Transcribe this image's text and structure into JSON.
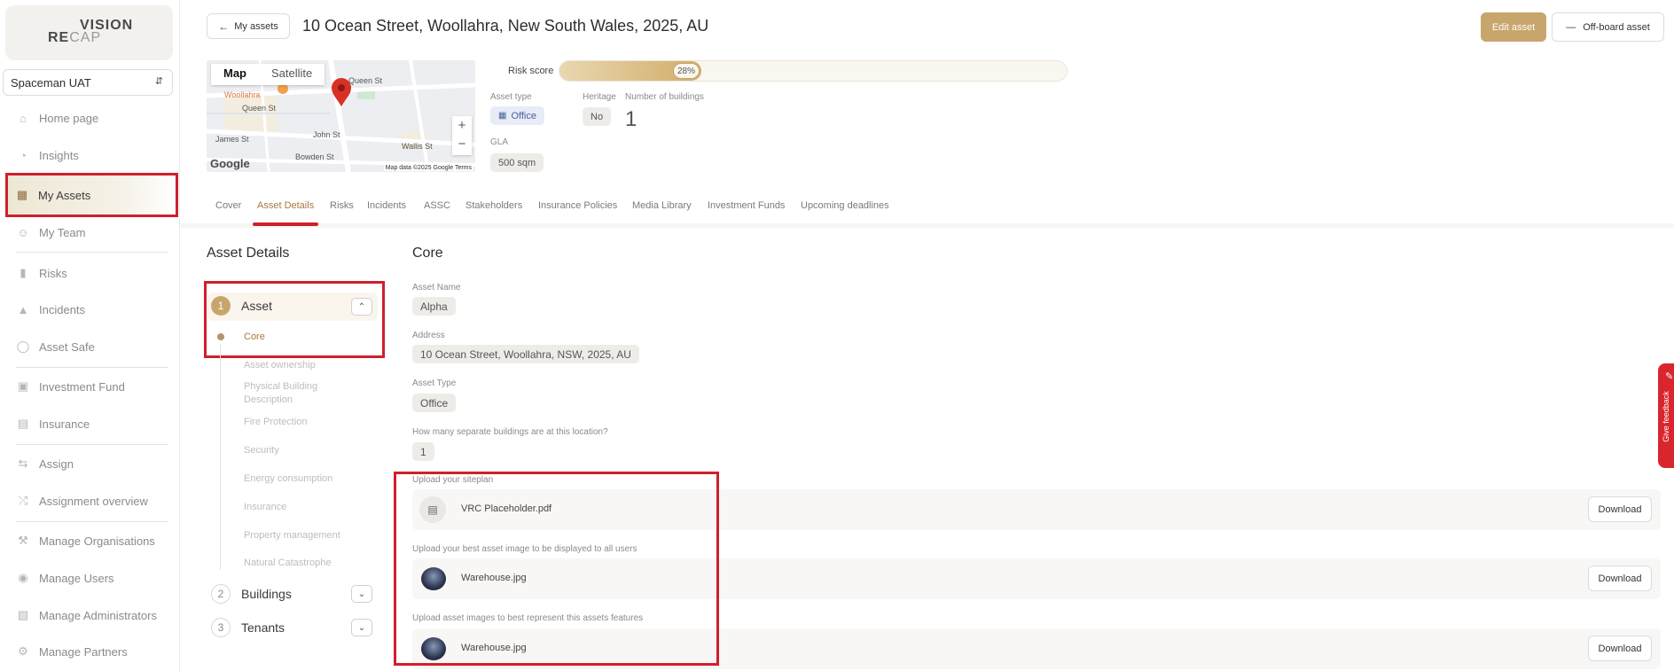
{
  "brand": {
    "line1": "VISION",
    "line2a": "RE",
    "line2b": "CAP"
  },
  "org_selector": {
    "value": "Spaceman UAT"
  },
  "sidebar": {
    "items": [
      {
        "label": "Home page",
        "icon": "home-icon"
      },
      {
        "label": "Insights",
        "icon": "insights-icon"
      },
      {
        "label": "My Assets",
        "icon": "building-icon",
        "active": true
      },
      {
        "label": "My Team",
        "icon": "team-icon"
      },
      {
        "label": "Risks",
        "icon": "chart-icon"
      },
      {
        "label": "Incidents",
        "icon": "flame-icon"
      },
      {
        "label": "Asset Safe",
        "icon": "shield-icon"
      },
      {
        "label": "Investment Fund",
        "icon": "wallet-icon"
      },
      {
        "label": "Insurance",
        "icon": "document-icon"
      },
      {
        "label": "Assign",
        "icon": "swap-icon"
      },
      {
        "label": "Assignment overview",
        "icon": "shuffle-icon"
      },
      {
        "label": "Manage Organisations",
        "icon": "wrench-icon"
      },
      {
        "label": "Manage Users",
        "icon": "user-icon"
      },
      {
        "label": "Manage Administrators",
        "icon": "admin-icon"
      },
      {
        "label": "Manage Partners",
        "icon": "gear-icon"
      }
    ]
  },
  "header": {
    "back_label": "My assets",
    "title": "10 Ocean Street, Woollahra, New South Wales, 2025, AU",
    "edit_label": "Edit asset",
    "offboard_label": "Off-board asset"
  },
  "map": {
    "tab_map": "Map",
    "tab_satellite": "Satellite",
    "attribution": "Map data ©2025 Google",
    "terms": "Terms",
    "google": "Google"
  },
  "risk": {
    "label": "Risk score",
    "percent_text": "28%",
    "percent": 28
  },
  "asset_meta": {
    "asset_type_label": "Asset type",
    "asset_type_value": "Office",
    "heritage_label": "Heritage",
    "heritage_value": "No",
    "buildings_label": "Number of buildings",
    "buildings_value": "1",
    "gla_label": "GLA",
    "gla_value": "500 sqm"
  },
  "tabs": [
    "Cover",
    "Asset Details",
    "Risks",
    "Incidents",
    "ASSC",
    "Stakeholders",
    "Insurance Policies",
    "Media Library",
    "Investment Funds",
    "Upcoming deadlines"
  ],
  "active_tab": "Asset Details",
  "details": {
    "heading": "Asset Details",
    "steps": [
      {
        "num": "1",
        "label": "Asset"
      },
      {
        "num": "2",
        "label": "Buildings"
      },
      {
        "num": "3",
        "label": "Tenants"
      }
    ],
    "sub_items": [
      "Core",
      "Asset ownership",
      "Physical Building Description",
      "Fire Protection",
      "Security",
      "Energy consumption",
      "Insurance",
      "Property management",
      "Natural Catastrophe"
    ]
  },
  "core": {
    "heading": "Core",
    "asset_name_label": "Asset Name",
    "asset_name_value": "Alpha",
    "address_label": "Address",
    "address_value": "10 Ocean Street, Woollahra, NSW, 2025, AU",
    "asset_type_label": "Asset Type",
    "asset_type_value": "Office",
    "buildings_q": "How many separate buildings are at this location?",
    "buildings_value": "1"
  },
  "uploads": [
    {
      "label": "Upload your siteplan",
      "file": "VRC Placeholder.pdf",
      "kind": "pdf",
      "button": "Download"
    },
    {
      "label": "Upload your best asset image to be displayed to all users",
      "file": "Warehouse.jpg",
      "kind": "image",
      "button": "Download"
    },
    {
      "label": "Upload asset images to best represent this assets features",
      "file": "Warehouse.jpg",
      "kind": "image",
      "button": "Download"
    }
  ],
  "feedback": {
    "label": "Give feedback"
  },
  "colors": {
    "accent": "#c8a66b",
    "highlight": "#d01f2c"
  }
}
